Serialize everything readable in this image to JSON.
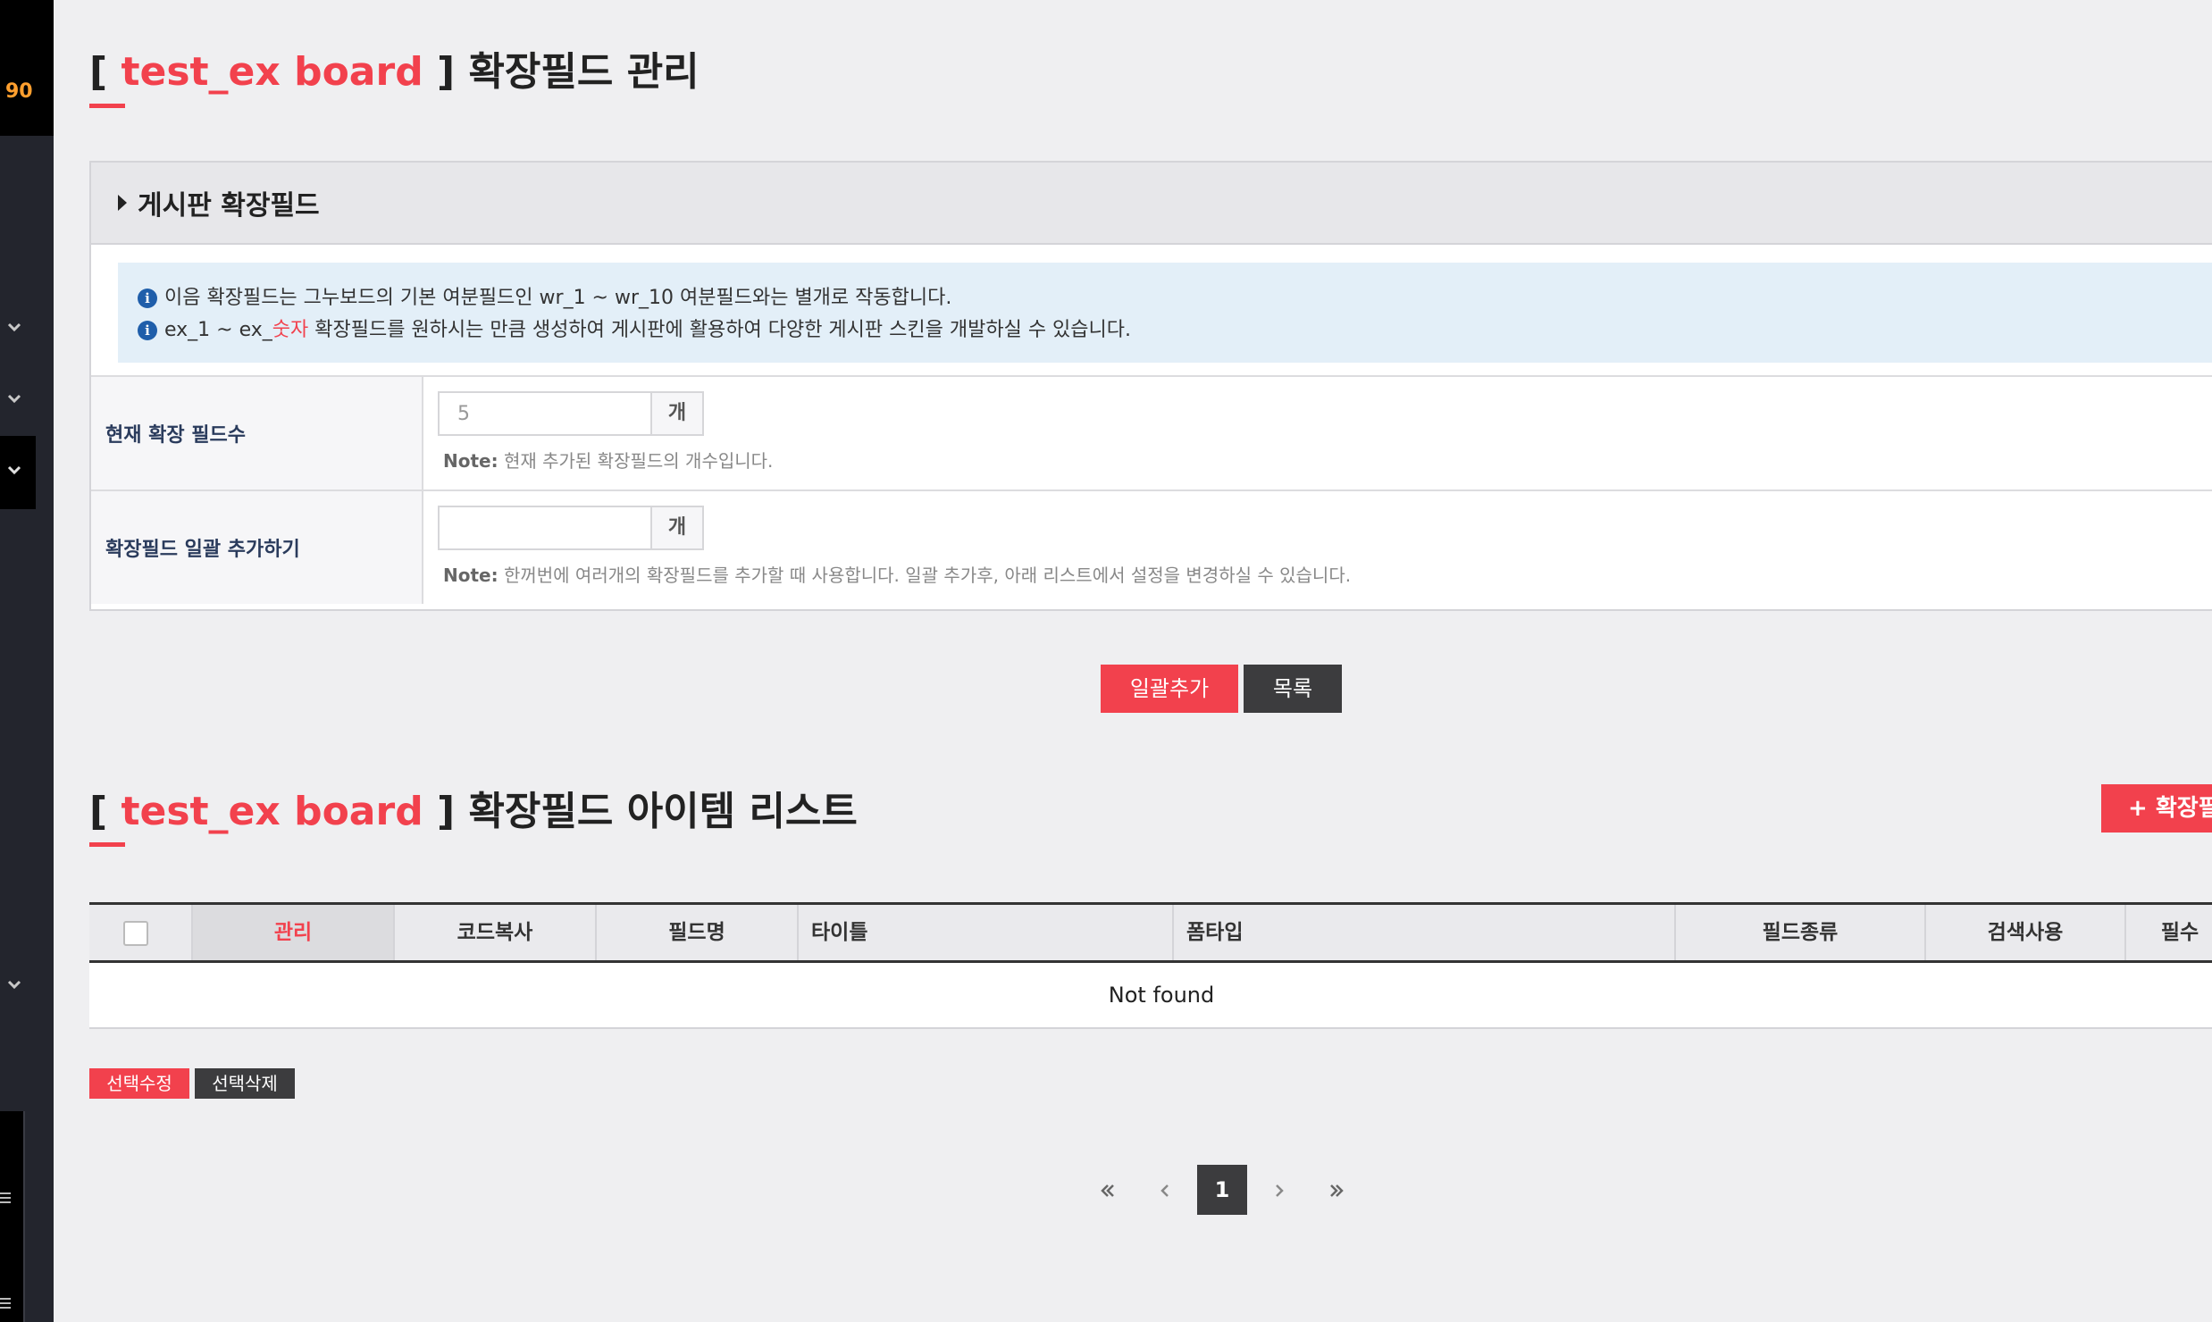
{
  "sidebar": {
    "counter": "90"
  },
  "header": {
    "bracket_open": "[",
    "board_name": "test_ex board",
    "bracket_close": "]",
    "title_suffix": "확장필드 관리"
  },
  "panel": {
    "heading": "게시판 확장필드",
    "info": {
      "line1": "이음 확장필드는 그누보드의 기본 여분필드인 wr_1 ~ wr_10 여분필드와는 별개로 작동합니다.",
      "line2_prefix": "ex_1 ~ ex_",
      "line2_highlight": "숫자",
      "line2_suffix": " 확장필드를 원하시는 만큼 생성하여 게시판에 활용하여 다양한 게시판 스킨을 개발하실 수 있습니다."
    },
    "rows": [
      {
        "label": "현재 확장 필드수",
        "value": "5",
        "unit": "개",
        "note_label": "Note:",
        "note_text": " 현재 추가된 확장필드의 개수입니다."
      },
      {
        "label": "확장필드 일괄 추가하기",
        "value": "",
        "unit": "개",
        "note_label": "Note:",
        "note_text": " 한꺼번에 여러개의 확장필드를 추가할 때 사용합니다. 일괄 추가후, 아래 리스트에서 설정을 변경하실 수 있습니다."
      }
    ]
  },
  "actions": {
    "bulk_add": "일괄추가",
    "list": "목록"
  },
  "list_section": {
    "bracket_open": "[",
    "board_name": "test_ex board",
    "bracket_close": "]",
    "title_suffix": "확장필드 아이템 리스트",
    "add_button": "+ 확장필드"
  },
  "table": {
    "columns": [
      "관리",
      "코드복사",
      "필드명",
      "타이틀",
      "폼타입",
      "필드종류",
      "검색사용",
      "필수"
    ],
    "empty_text": "Not found"
  },
  "bulk_actions": {
    "edit_selected": "선택수정",
    "delete_selected": "선택삭제"
  },
  "pagination": {
    "current_page": "1"
  },
  "colors": {
    "accent": "#f2414d",
    "dark_button": "#3c3c3e",
    "sidebar": "#23252d",
    "info_bg": "#e3eff8"
  }
}
